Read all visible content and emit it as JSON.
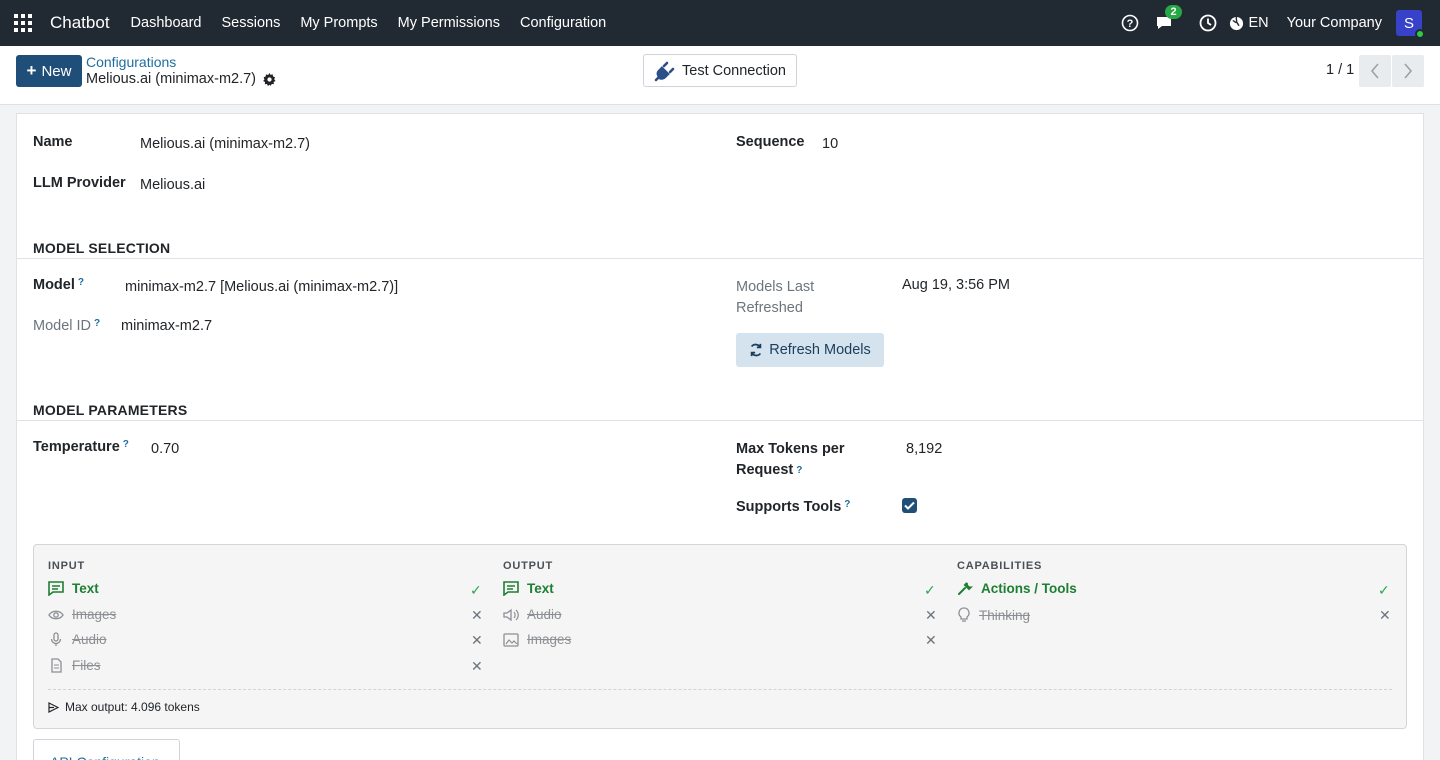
{
  "navbar": {
    "brand": "Chatbot",
    "items": [
      "Dashboard",
      "Sessions",
      "My Prompts",
      "My Permissions",
      "Configuration"
    ],
    "message_count": "2",
    "language": "EN",
    "company": "Your Company",
    "avatar_letter": "S"
  },
  "control_panel": {
    "new_label": "New",
    "breadcrumb": "Configurations",
    "record_title": "Melious.ai (minimax-m2.7)",
    "test_connection_label": "Test Connection",
    "pager": "1 / 1"
  },
  "form": {
    "name_label": "Name",
    "name_value": "Melious.ai (minimax-m2.7)",
    "provider_label": "LLM Provider",
    "provider_value": "Melious.ai",
    "sequence_label": "Sequence",
    "sequence_value": "10",
    "model_selection": {
      "title": "MODEL SELECTION",
      "model_label": "Model",
      "model_value": "minimax-m2.7 [Melious.ai (minimax-m2.7)]",
      "model_id_label": "Model ID",
      "model_id_value": "minimax-m2.7",
      "refreshed_label_line1": "Models Last",
      "refreshed_label_line2": "Refreshed",
      "refreshed_value": "Aug 19, 3:56 PM",
      "refresh_button": "Refresh Models"
    },
    "model_parameters": {
      "title": "MODEL PARAMETERS",
      "temperature_label": "Temperature",
      "temperature_value": "0.70",
      "max_tokens_label_line1": "Max Tokens per",
      "max_tokens_label_line2": "Request",
      "max_tokens_value": "8,192",
      "supports_tools_label": "Supports Tools",
      "supports_tools_checked": true
    },
    "capabilities": {
      "input_title": "INPUT",
      "output_title": "OUTPUT",
      "capabilities_title": "CAPABILITIES",
      "input": [
        {
          "label": "Text",
          "enabled": true,
          "icon": "chat-icon"
        },
        {
          "label": "Images",
          "enabled": false,
          "icon": "eye-icon"
        },
        {
          "label": "Audio",
          "enabled": false,
          "icon": "microphone-icon"
        },
        {
          "label": "Files",
          "enabled": false,
          "icon": "file-icon"
        }
      ],
      "output": [
        {
          "label": "Text",
          "enabled": true,
          "icon": "chat-icon"
        },
        {
          "label": "Audio",
          "enabled": false,
          "icon": "speaker-icon"
        },
        {
          "label": "Images",
          "enabled": false,
          "icon": "image-icon"
        }
      ],
      "capabilities": [
        {
          "label": "Actions / Tools",
          "enabled": true,
          "icon": "wrench-icon"
        },
        {
          "label": "Thinking",
          "enabled": false,
          "icon": "lightbulb-icon"
        }
      ],
      "max_output": "Max output: 4.096 tokens"
    },
    "api_tab": "API Configuration"
  },
  "colors": {
    "navbar_bg": "#212a33",
    "primary": "#1f4e79",
    "link": "#1d6e9f",
    "success": "#28a745"
  }
}
